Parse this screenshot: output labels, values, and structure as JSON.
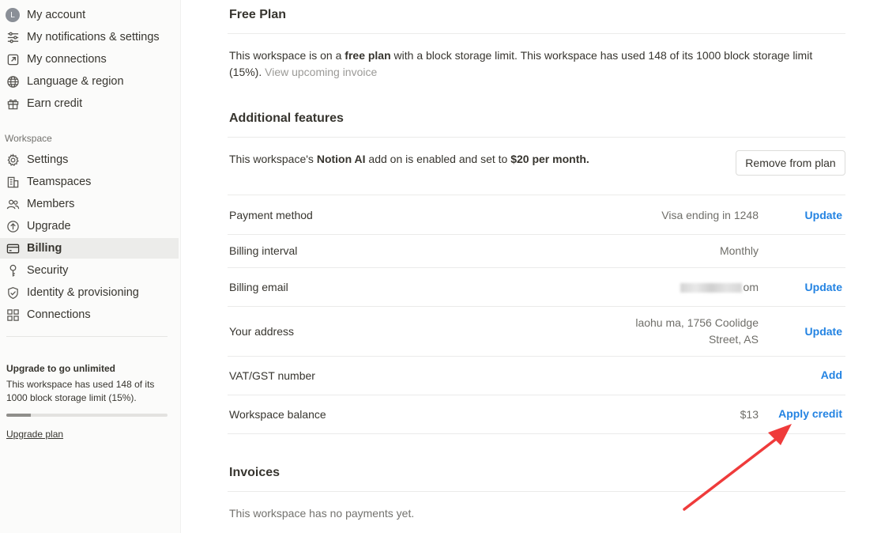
{
  "sidebar": {
    "account_items": [
      {
        "label": "My account",
        "icon": "avatar-icon",
        "avatar_letter": "L"
      },
      {
        "label": "My notifications & settings",
        "icon": "sliders-icon"
      },
      {
        "label": "My connections",
        "icon": "external-link-icon"
      },
      {
        "label": "Language & region",
        "icon": "globe-icon"
      },
      {
        "label": "Earn credit",
        "icon": "gift-icon"
      }
    ],
    "workspace_label": "Workspace",
    "workspace_items": [
      {
        "label": "Settings",
        "icon": "gear-icon"
      },
      {
        "label": "Teamspaces",
        "icon": "building-icon"
      },
      {
        "label": "Members",
        "icon": "people-icon"
      },
      {
        "label": "Upgrade",
        "icon": "arrow-up-circle-icon"
      },
      {
        "label": "Billing",
        "icon": "credit-card-icon",
        "active": true
      },
      {
        "label": "Security",
        "icon": "key-icon"
      },
      {
        "label": "Identity & provisioning",
        "icon": "shield-check-icon"
      },
      {
        "label": "Connections",
        "icon": "grid-icon"
      }
    ],
    "upsell": {
      "title": "Upgrade to go unlimited",
      "description": "This workspace has used 148 of its 1000 block storage limit (15%).",
      "progress": 0.15,
      "link": "Upgrade plan"
    }
  },
  "main": {
    "plan_title": "Free Plan",
    "plan_text_1": "This workspace is on a ",
    "plan_text_bold": "free plan",
    "plan_text_2": " with a block storage limit. This workspace has used 148 of its 1000 block storage limit (15%).",
    "plan_link": "View upcoming invoice",
    "features_title": "Additional features",
    "features_text_1": "This workspace's ",
    "features_text_bold_1": "Notion AI",
    "features_text_2": " add on is enabled and set to ",
    "features_text_bold_2": "$20 per month.",
    "remove_button": "Remove from plan",
    "rows": [
      {
        "label": "Payment method",
        "value": "Visa ending in 1248",
        "action": "Update"
      },
      {
        "label": "Billing interval",
        "value": "Monthly",
        "action": ""
      },
      {
        "label": "Billing email",
        "value_suffix": "om",
        "action": "Update"
      },
      {
        "label": "Your address",
        "value_line1": "laohu ma, 1756 Coolidge",
        "value_line2": "Street, AS",
        "action": "Update"
      },
      {
        "label": "VAT/GST number",
        "value": "",
        "action": "Add"
      },
      {
        "label": "Workspace balance",
        "value": "$13",
        "action": "Apply credit"
      }
    ],
    "invoices_title": "Invoices",
    "invoices_empty": "This workspace has no payments yet."
  },
  "colors": {
    "accent_blue": "#2383e2",
    "annotation_arrow": "#ef3b3b",
    "sidebar_bg": "#fbfbfa"
  }
}
